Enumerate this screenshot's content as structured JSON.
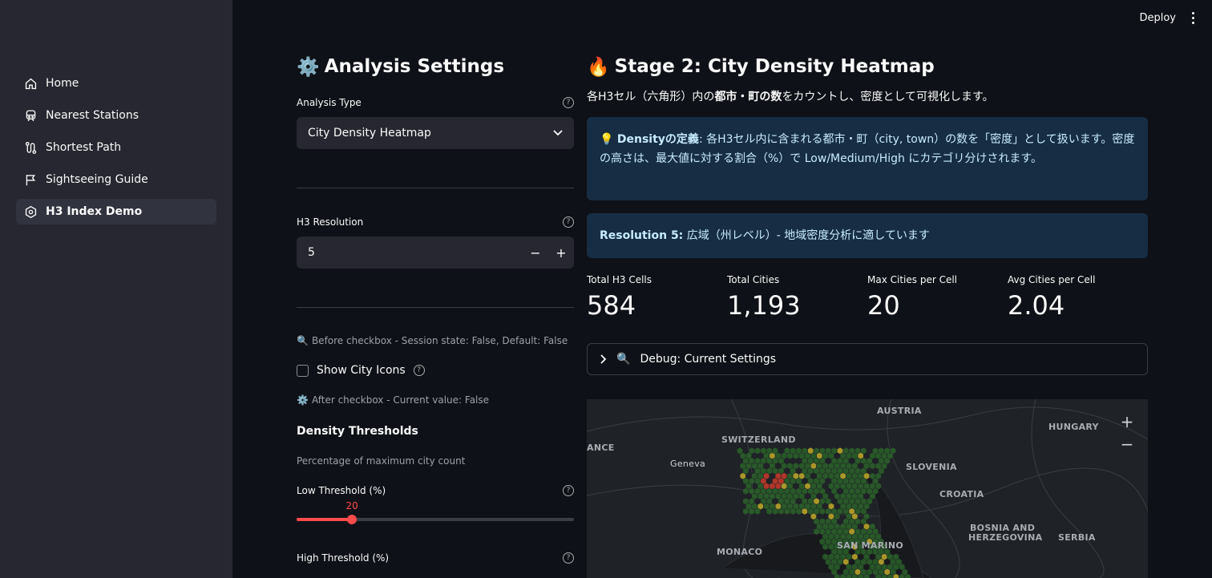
{
  "topbar": {
    "deploy_label": "Deploy"
  },
  "sidebar": {
    "items": [
      {
        "label": "Home",
        "icon": "home-icon"
      },
      {
        "label": "Nearest Stations",
        "icon": "train-icon"
      },
      {
        "label": "Shortest Path",
        "icon": "route-icon"
      },
      {
        "label": "Sightseeing Guide",
        "icon": "flag-icon"
      },
      {
        "label": "H3 Index Demo",
        "icon": "hexagon-icon",
        "active": true
      }
    ]
  },
  "settings": {
    "title": "Analysis Settings",
    "analysis_type_label": "Analysis Type",
    "analysis_type_value": "City Density Heatmap",
    "resolution_label": "H3 Resolution",
    "resolution_value": "5",
    "before_caption": "Before checkbox - Session state: False, Default: False",
    "show_icons_label": "Show City Icons",
    "after_caption": "After checkbox - Current value: False",
    "thresholds_heading": "Density Thresholds",
    "thresholds_caption": "Percentage of maximum city count",
    "low_label": "Low Threshold (%)",
    "low_value": 20,
    "low_value_text": "20",
    "high_label": "High Threshold (%)"
  },
  "stage": {
    "title": "Stage 2: City Density Heatmap",
    "desc_pre": "各H3セル（六角形）内の",
    "desc_bold": "都市・町の数",
    "desc_post": "をカウントし、密度として可視化します。",
    "info1_bold": "Densityの定義",
    "info1_text": ": 各H3セル内に含まれる都市・町（city, town）の数を「密度」として扱います。密度の高さは、最大値に対する割合（%）で Low/Medium/High にカテゴリ分けされます。",
    "info2_bold": "Resolution 5:",
    "info2_text": " 広域（州レベル）- 地域密度分析に適しています",
    "metrics": [
      {
        "label": "Total H3 Cells",
        "value": "584"
      },
      {
        "label": "Total Cities",
        "value": "1,193"
      },
      {
        "label": "Max Cities per Cell",
        "value": "20"
      },
      {
        "label": "Avg Cities per Cell",
        "value": "2.04"
      }
    ],
    "debug_label": "Debug: Current Settings"
  },
  "map": {
    "labels": [
      "AUSTRIA",
      "HUNGARY",
      "SWITZERLAND",
      "ANCE",
      "Geneva",
      "SLOVENIA",
      "CROATIA",
      "BOSNIA AND",
      "HERZEGOVINA",
      "SERBIA",
      "MONACO",
      "SAN MARINO"
    ],
    "zoom_in": "+",
    "zoom_out": "−"
  },
  "colors": {
    "accent": "#ff4b4b",
    "low": "#2e6b2b",
    "medium": "#b8a42a",
    "high": "#c0392b"
  }
}
